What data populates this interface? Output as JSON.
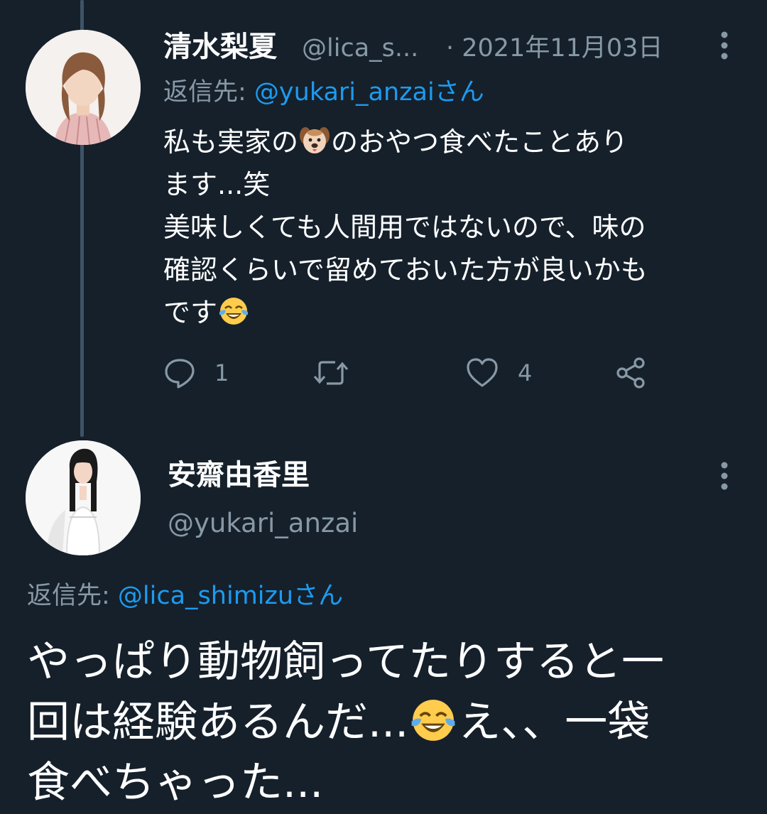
{
  "colors": {
    "background": "#15202b",
    "secondary_text": "#8899a6",
    "link": "#1d9bf0",
    "thread_line": "#3d5466"
  },
  "reply_tweet": {
    "author_name": "清水梨夏",
    "author_handle": "@lica_s...",
    "date": "· 2021年11月03日",
    "reply_prefix": "返信先: ",
    "reply_to": "@yukari_anzaiさん",
    "body_lines": [
      "私も実家の",
      "のおやつ食べたことあり",
      "ます...笑",
      "美味しくても人間用ではないので、味の",
      "確認くらいで留めておいた方が良いかも",
      "です"
    ],
    "emojis": [
      "dog-face-emoji",
      "tears-of-joy-emoji"
    ],
    "actions": {
      "reply_count": "1",
      "retweet_count": "",
      "like_count": "4"
    },
    "icons": [
      "more-vertical-icon",
      "comment-icon",
      "retweet-icon",
      "heart-icon",
      "share-icon"
    ]
  },
  "main_tweet": {
    "author_name": "安齋由香里",
    "author_handle": "@yukari_anzai",
    "reply_prefix": "返信先: ",
    "reply_to": "@lica_shimizuさん",
    "body_lines": [
      "やっぱり動物飼ってたりすると一",
      "回は経験あるんだ...",
      "え、、一袋",
      "食べちゃった..."
    ],
    "emojis": [
      "tears-of-joy-emoji"
    ],
    "icons": [
      "more-vertical-icon"
    ]
  }
}
